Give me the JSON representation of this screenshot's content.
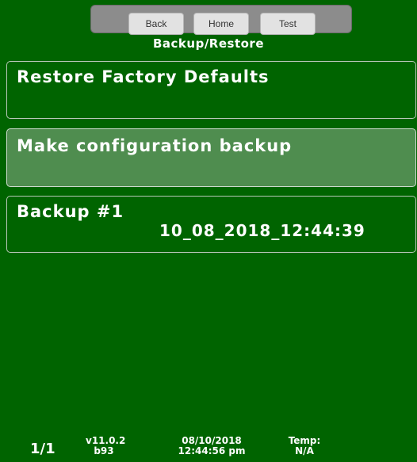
{
  "nav": {
    "back_label": "Back",
    "home_label": "Home",
    "test_label": "Test"
  },
  "title": "Backup/Restore",
  "actions": {
    "restore_label": "Restore Factory Defaults",
    "backup_label": "Make configuration backup"
  },
  "backups": [
    {
      "name": "Backup #1",
      "date": "10_08_2018_12:44:39"
    }
  ],
  "footer": {
    "page": "1/1",
    "version": "v11.0.2",
    "build": "b93",
    "date": "08/10/2018",
    "time": "12:44:56 pm",
    "temp_label": "Temp:",
    "temp_value": "N/A"
  },
  "colors": {
    "background": "#006400",
    "highlight": "#4f8d4f"
  }
}
